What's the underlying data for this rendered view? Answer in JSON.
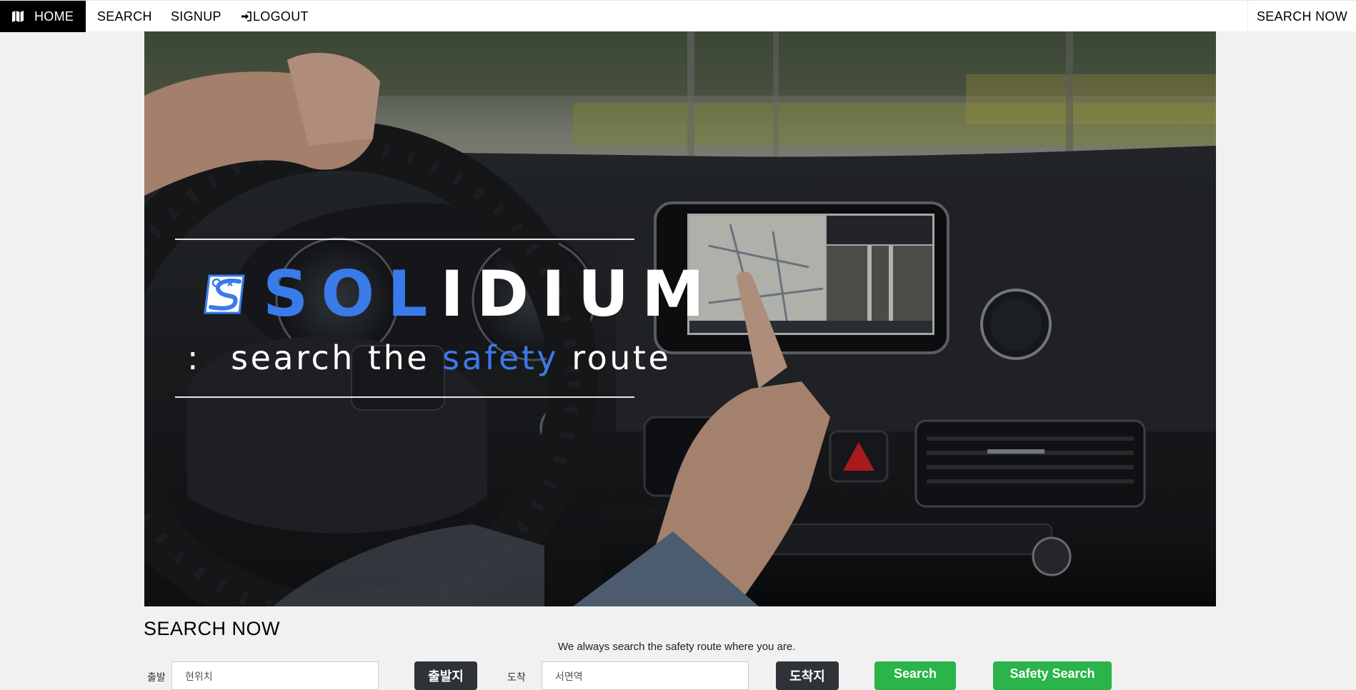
{
  "nav": {
    "home_label": "HOME",
    "search_label": "SEARCH",
    "signup_label": "SIGNUP",
    "logout_label": "LOGOUT",
    "right_label": "SEARCH NOW",
    "home_icon": "map-icon",
    "logout_icon": "sign-in-icon"
  },
  "hero": {
    "brand_blue": "SOL",
    "brand_white": "IDIUM",
    "tagline_colon": ":",
    "tagline_pre": "search the",
    "tagline_highlight": "safety",
    "tagline_post": "route",
    "accent_color": "#3a7bea"
  },
  "search_section": {
    "title": "SEARCH NOW",
    "description": "We always search the safety route where you are.",
    "start_label": "출발",
    "start_value": "현위치",
    "start_button": "출발지",
    "end_label": "도착",
    "end_value": "서면역",
    "end_button": "도착지",
    "search_button": "Search",
    "safety_button": "Safety Search"
  }
}
